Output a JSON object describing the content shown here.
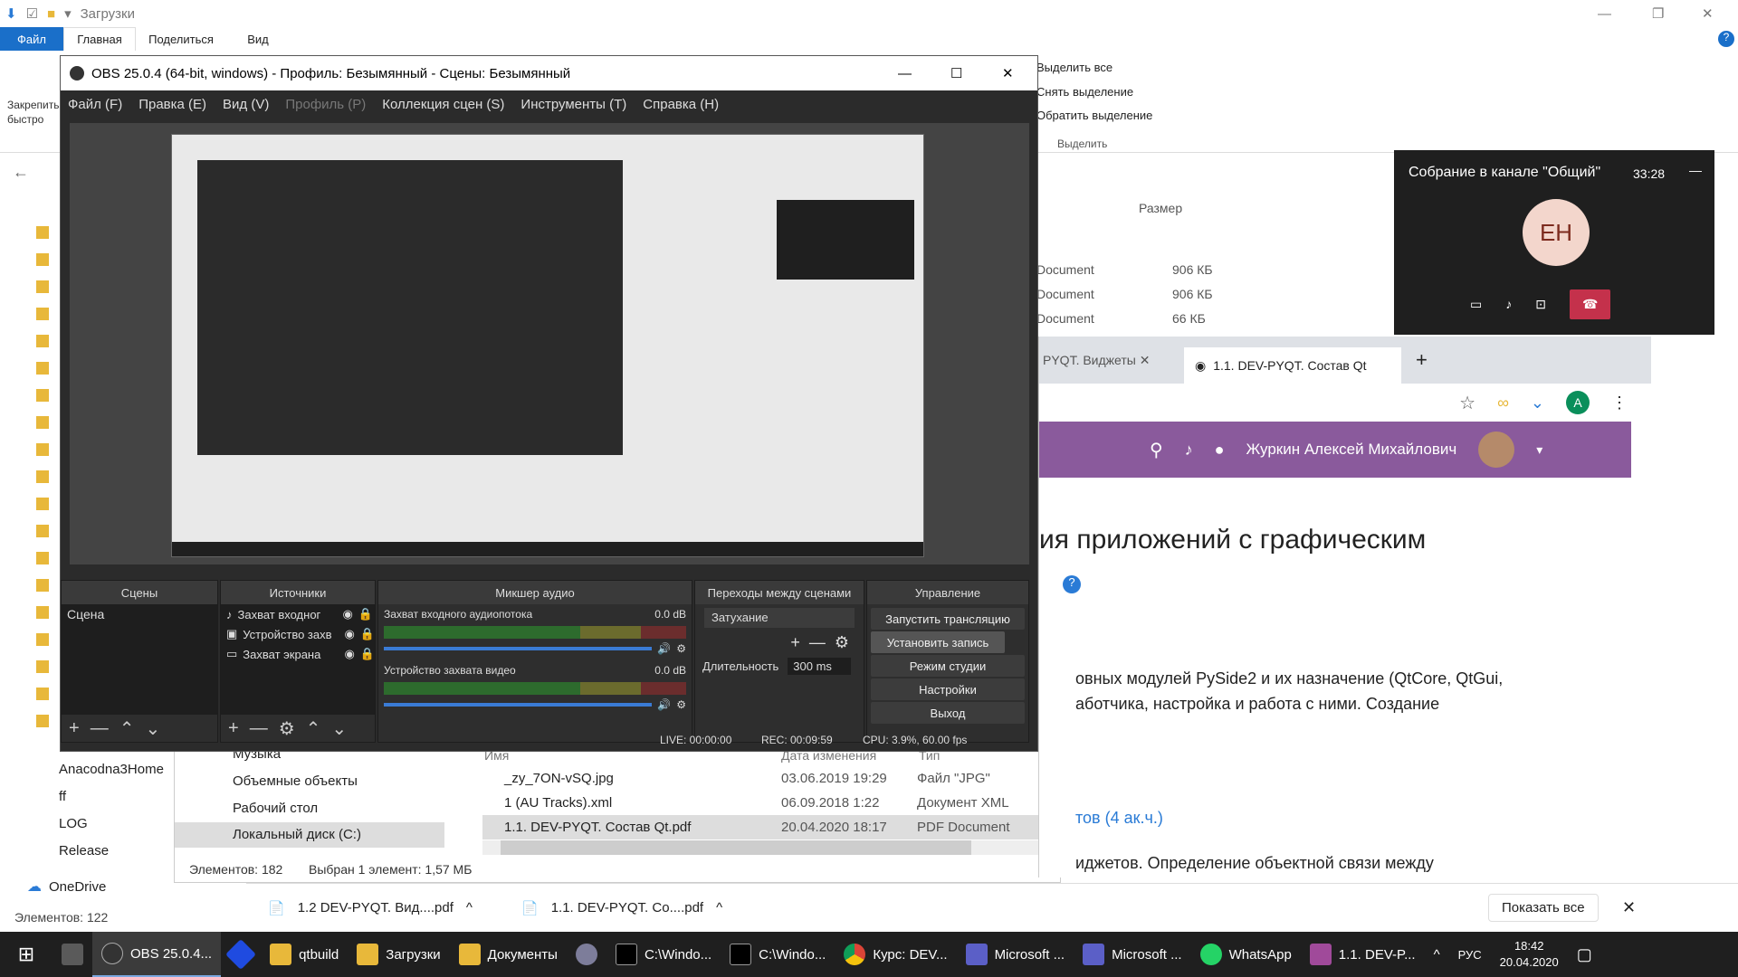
{
  "explorer": {
    "title": "Загрузки",
    "tabs": [
      "Файл",
      "Главная",
      "Поделиться",
      "Вид"
    ],
    "ribbon_right": [
      "Выделить все",
      "Снять выделение",
      "Обратить выделение"
    ],
    "ribbon_group": "Выделить",
    "pin_label": "Закрепить быстро",
    "size_header": "Размер",
    "rows": [
      {
        "type": "Document",
        "size": "906 КБ"
      },
      {
        "type": "Document",
        "size": "906 КБ"
      },
      {
        "type": "Document",
        "size": "66 КБ"
      }
    ],
    "sidebar": [
      "Anacodna3Home",
      "ff",
      "LOG",
      "Release"
    ],
    "onedrive": "OneDrive",
    "status": "Элементов: 122"
  },
  "explorer2": {
    "nav": [
      "Музыка",
      "Объемные объекты",
      "Рабочий стол",
      "Локальный диск (C:)"
    ],
    "headers": [
      "Имя",
      "Дата изменения",
      "Тип"
    ],
    "files": [
      {
        "name": "_zy_7ON-vSQ.jpg",
        "date": "03.06.2019 19:29",
        "type": "Файл \"JPG\""
      },
      {
        "name": "1 (AU Tracks).xml",
        "date": "06.09.2018 1:22",
        "type": "Документ XML"
      },
      {
        "name": "1.1. DEV-PYQT. Состав Qt.pdf",
        "date": "20.04.2020 18:17",
        "type": "PDF Document"
      }
    ],
    "status_count": "Элементов: 182",
    "status_sel": "Выбран 1 элемент: 1,57 МБ"
  },
  "obs": {
    "title": "OBS 25.0.4 (64-bit, windows) - Профиль: Безымянный - Сцены: Безымянный",
    "menu": [
      "Файл (F)",
      "Правка (E)",
      "Вид (V)",
      "Профиль (P)",
      "Коллекция сцен (S)",
      "Инструменты (T)",
      "Справка (H)"
    ],
    "docks": {
      "scenes": "Сцены",
      "sources": "Источники",
      "mixer": "Микшер аудио",
      "transitions": "Переходы между сценами",
      "controls": "Управление"
    },
    "scene_item": "Сцена",
    "sources": [
      "Захват входног",
      "Устройство захв",
      "Захват экрана"
    ],
    "mixer": [
      {
        "name": "Захват входного аудиопотока",
        "db": "0.0 dB"
      },
      {
        "name": "Устройство захвата видео",
        "db": "0.0 dB"
      }
    ],
    "transition": "Затухание",
    "duration_label": "Длительность",
    "duration": "300 ms",
    "controls": [
      "Запустить трансляцию",
      "Установить запись",
      "Режим студии",
      "Настройки",
      "Выход"
    ],
    "status": {
      "live": "LIVE: 00:00:00",
      "rec": "REC: 00:09:59",
      "cpu": "CPU: 3.9%, 60.00 fps"
    }
  },
  "browser": {
    "tabs": [
      "PYQT. Виджеты",
      "1.1. DEV-PYQT. Состав Qt"
    ],
    "user": "Журкин Алексей Михайлович",
    "avatar": "A",
    "heading": "ия приложений с графическим",
    "text1": "овных модулей PySide2 и их назначение (QtCore, QtGui,",
    "text2": "аботчика, настройка и работа с ними. Создание",
    "link": "тов (4 ак.ч.)",
    "text3": "иджетов. Определение объектной связи между"
  },
  "teams": {
    "title": "Собрание в канале \"Общий\"",
    "time": "33:28",
    "initials": "EH"
  },
  "downloads": {
    "items": [
      "1.2 DEV-PYQT. Вид....pdf",
      "1.1. DEV-PYQT. Co....pdf"
    ],
    "show_all": "Показать все"
  },
  "taskbar": {
    "items": [
      "OBS 25.0.4...",
      "qtbuild",
      "Загрузки",
      "Документы",
      "C:\\Windo...",
      "C:\\Windo...",
      "Курс: DEV...",
      "Microsoft ...",
      "Microsoft ...",
      "WhatsApp",
      "1.1. DEV-P..."
    ],
    "lang": "РУС",
    "time": "18:42",
    "date": "20.04.2020"
  }
}
